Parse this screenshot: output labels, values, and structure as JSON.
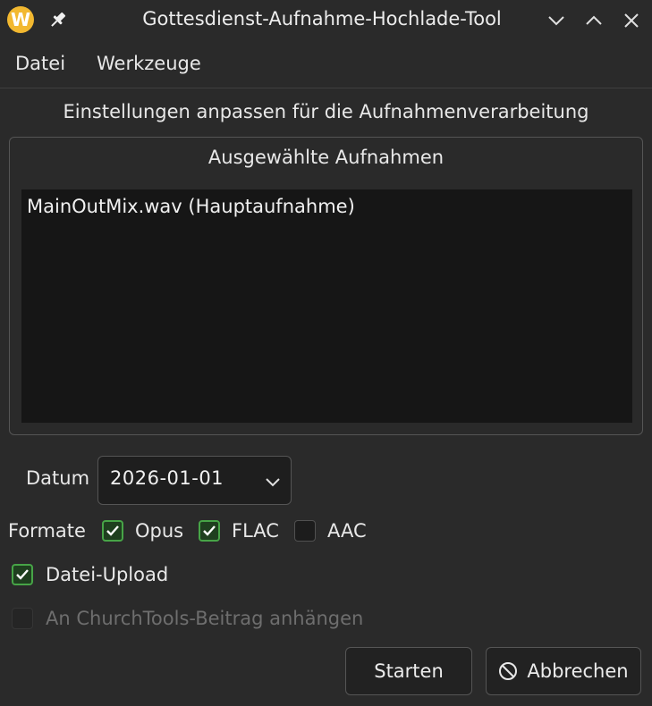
{
  "window": {
    "title": "Gottesdienst-Aufnahme-Hochlade-Tool",
    "app_icon_letter": "W",
    "app_icon_color": "#f2b830"
  },
  "menu": {
    "items": [
      "Datei",
      "Werkzeuge"
    ]
  },
  "heading": "Einstellungen anpassen für die Aufnahmenverarbeitung",
  "recordings": {
    "group_title": "Ausgewählte Aufnahmen",
    "items": [
      "MainOutMix.wav (Hauptaufnahme)"
    ]
  },
  "date": {
    "label": "Datum",
    "value": "2026-01-01"
  },
  "formats": {
    "label": "Formate",
    "options": [
      {
        "label": "Opus",
        "checked": true
      },
      {
        "label": "FLAC",
        "checked": true
      },
      {
        "label": "AAC",
        "checked": false
      }
    ]
  },
  "upload": {
    "label": "Datei-Upload",
    "checked": true
  },
  "churchtools": {
    "label": "An ChurchTools-Beitrag anhängen",
    "checked": false,
    "enabled": false
  },
  "buttons": {
    "start": "Starten",
    "cancel": "Abbrechen"
  },
  "colors": {
    "accent_check": "#47a447",
    "background": "#2a2a2a",
    "list_background": "#161616"
  }
}
